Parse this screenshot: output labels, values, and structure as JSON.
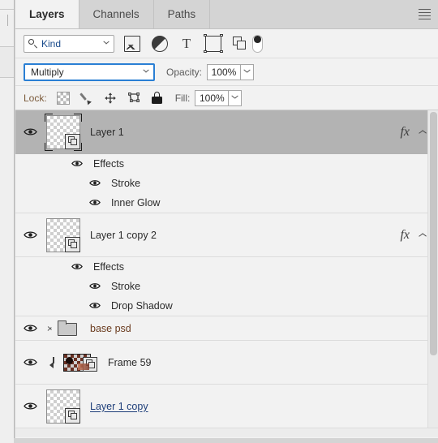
{
  "window": {
    "panel_title": "Layers"
  },
  "tabs": [
    {
      "label": "Layers",
      "active": true
    },
    {
      "label": "Channels",
      "active": false
    },
    {
      "label": "Paths",
      "active": false
    }
  ],
  "panel_menu": {
    "icon": "hamburger-menu-icon"
  },
  "filter_row": {
    "kind_label": "Kind",
    "icons": [
      {
        "name": "filter-pixel-layers-icon"
      },
      {
        "name": "filter-adjustment-layers-icon"
      },
      {
        "name": "filter-type-layers-icon"
      },
      {
        "name": "filter-shape-layers-icon"
      },
      {
        "name": "filter-smart-object-layers-icon"
      }
    ],
    "toggle_name": "filter-enable-toggle"
  },
  "blend_row": {
    "blend_mode": "Multiply",
    "opacity_label": "Opacity:",
    "opacity_value": "100%"
  },
  "lock_row": {
    "lock_label": "Lock:",
    "icons": [
      {
        "name": "lock-transparent-pixels-icon"
      },
      {
        "name": "lock-image-pixels-icon"
      },
      {
        "name": "lock-position-icon"
      },
      {
        "name": "lock-artboard-nesting-icon"
      },
      {
        "name": "lock-all-icon"
      }
    ],
    "fill_label": "Fill:",
    "fill_value": "100%"
  },
  "layers": [
    {
      "name": "Layer 1",
      "selected": true,
      "has_fx": true,
      "fx_mark": "fx",
      "thumb": "transparent-smart-object",
      "effects_group": "Effects",
      "effects": [
        "Stroke",
        "Inner Glow"
      ]
    },
    {
      "name": "Layer 1 copy 2",
      "selected": false,
      "has_fx": true,
      "fx_mark": "fx",
      "thumb": "transparent-smart-object",
      "effects_group": "Effects",
      "effects": [
        "Stroke",
        "Drop Shadow"
      ]
    },
    {
      "name": "base psd",
      "selected": false,
      "type": "group",
      "collapsed": true
    },
    {
      "name": "Frame 59",
      "selected": false,
      "type": "clipped",
      "thumb": "photo-smart-object"
    },
    {
      "name": "Layer 1 copy",
      "selected": false,
      "renaming": true,
      "thumb": "transparent-smart-object"
    }
  ],
  "colors": {
    "panel_bg": "#f2f2f2",
    "tabbar_bg": "#d4d4d4",
    "selected_row": "#b3b3b3",
    "focus_blue": "#2a7fd4",
    "kind_text_blue": "#1a4b8c",
    "lock_label_brown": "#7a5a3a"
  }
}
